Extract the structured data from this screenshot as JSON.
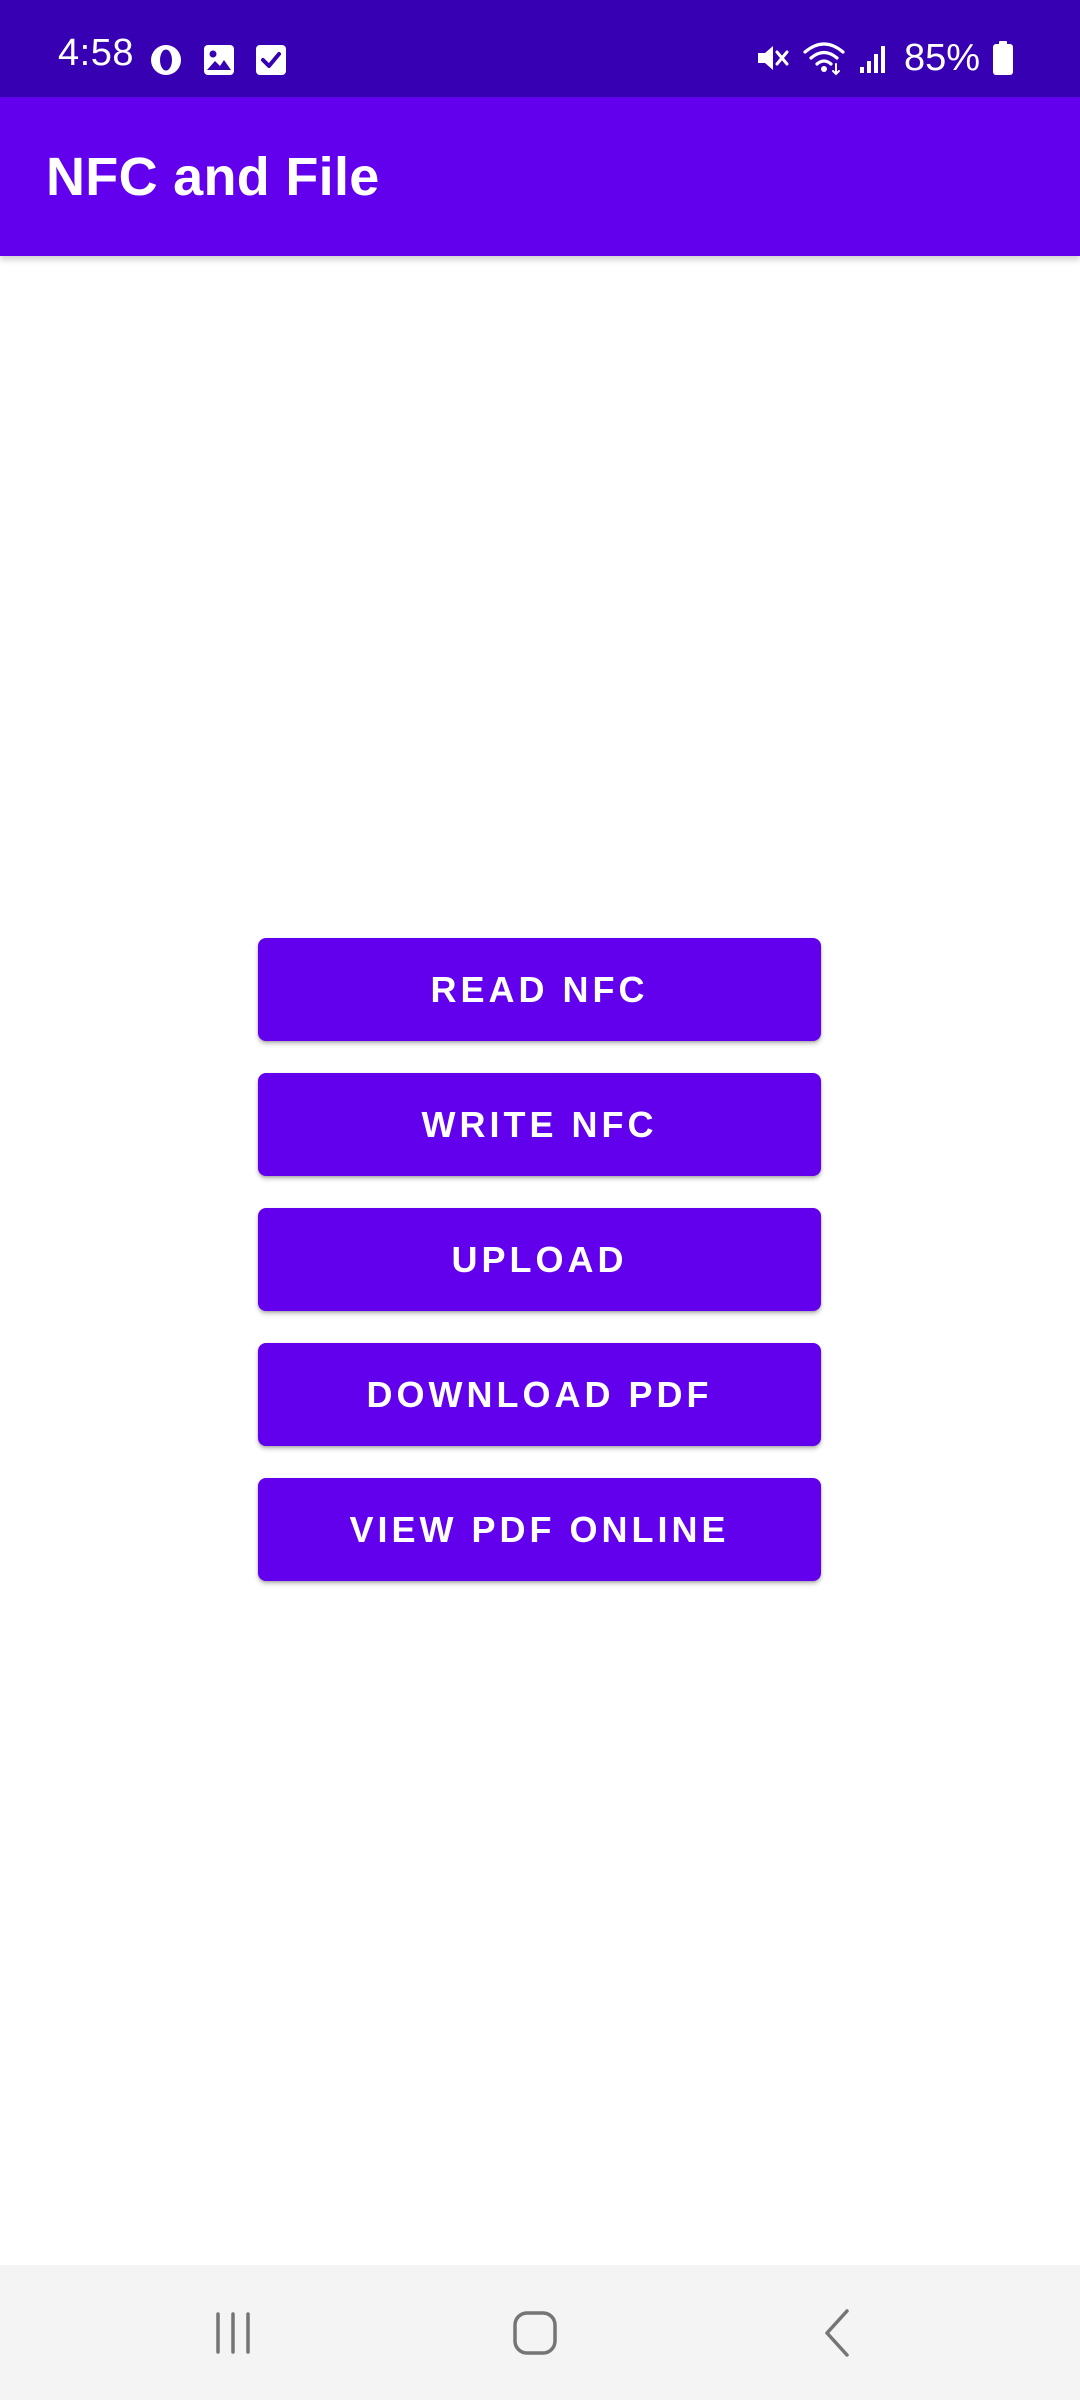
{
  "status_bar": {
    "time": "4:58",
    "left_icons": [
      "opera-icon",
      "gallery-icon",
      "checkbox-icon"
    ],
    "right_icons": [
      "mute-icon",
      "wifi-icon",
      "signal-icon",
      "battery-icon"
    ],
    "battery_text": "85%",
    "background_color": "#3700B3"
  },
  "app_bar": {
    "title": "NFC and File",
    "background_color": "#6200EE"
  },
  "buttons": [
    {
      "label": "READ NFC"
    },
    {
      "label": "WRITE NFC"
    },
    {
      "label": "UPLOAD"
    },
    {
      "label": "DOWNLOAD PDF"
    },
    {
      "label": "VIEW PDF ONLINE"
    }
  ],
  "button_color": "#6200EE",
  "nav_bar": {
    "items": [
      "recents-icon",
      "home-icon",
      "back-icon"
    ]
  }
}
